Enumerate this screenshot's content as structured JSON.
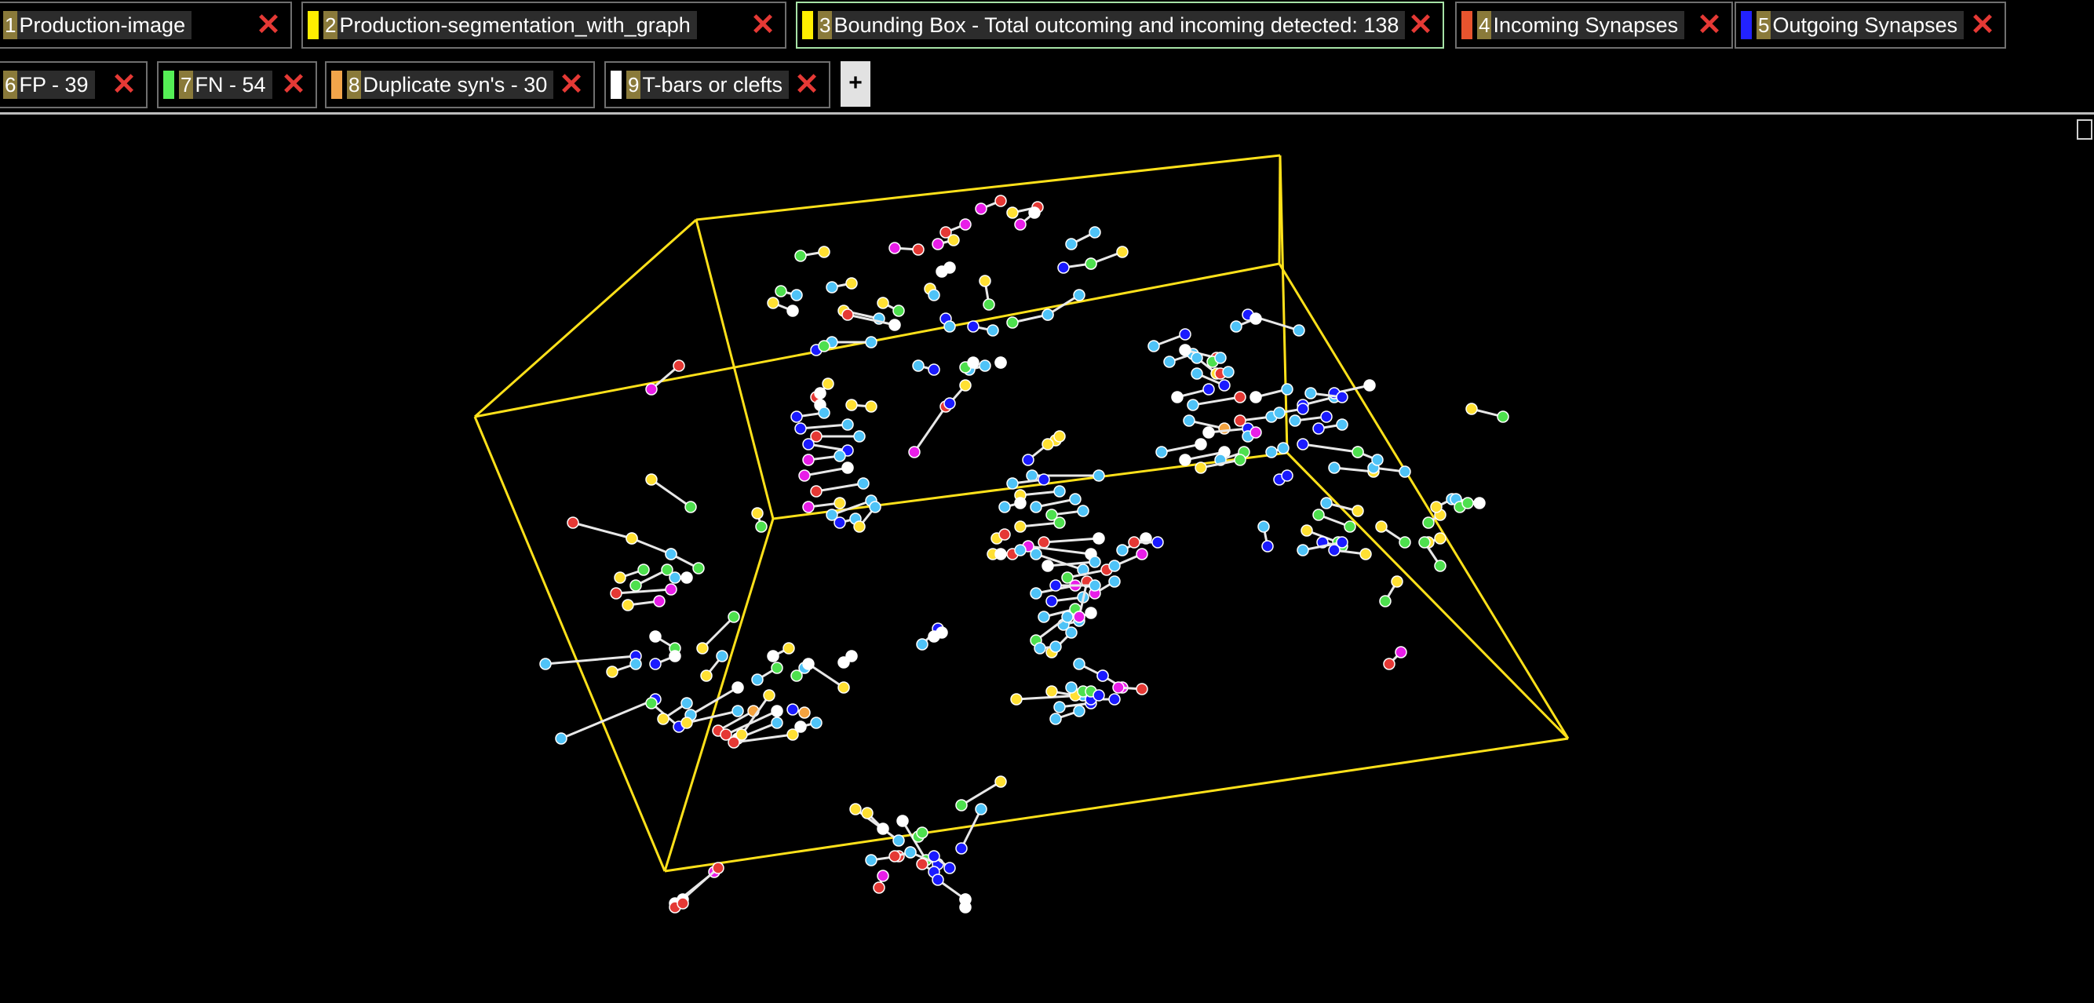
{
  "tabs": [
    {
      "num": "1",
      "label": "Production-image",
      "swatch": "#ffee00",
      "selected": false
    },
    {
      "num": "2",
      "label": "Production-segmentation_with_graph",
      "swatch": "#ffee00",
      "selected": false
    },
    {
      "num": "3",
      "label": "Bounding Box - Total outcoming and incoming detected: 138",
      "swatch": "#ffee00",
      "selected": true
    },
    {
      "num": "4",
      "label": "Incoming Synapses",
      "swatch": "#e8542e",
      "selected": false
    },
    {
      "num": "5",
      "label": "Outgoing Synapses",
      "swatch": "#2222ff",
      "selected": false
    },
    {
      "num": "6",
      "label": "FP - 39",
      "swatch": "#e53935",
      "selected": false
    },
    {
      "num": "7",
      "label": "FN - 54",
      "swatch": "#55ee55",
      "selected": false
    },
    {
      "num": "8",
      "label": "Duplicate syn's - 30",
      "swatch": "#f2a54a",
      "selected": false
    },
    {
      "num": "9",
      "label": "T-bars or clefts",
      "swatch": "#ffffff",
      "selected": false
    }
  ],
  "add_tab_label": "+",
  "close_glyph": "✕",
  "colors": {
    "box": "#ffe11a",
    "cyan": "#4fc3f7",
    "blue": "#1a1aff",
    "yellow": "#ffe033",
    "green": "#4ee04e",
    "red": "#e53935",
    "magenta": "#e81ee8",
    "white": "#ffffff",
    "orange": "#f4a340"
  }
}
